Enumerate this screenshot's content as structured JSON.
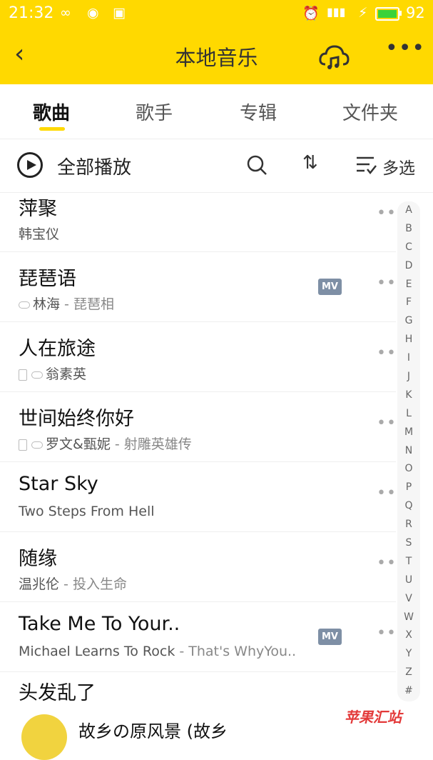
{
  "status_bar": {
    "time": "21:32",
    "battery": "92"
  },
  "header": {
    "title": "本地音乐",
    "back_icon": "chevron-left-icon",
    "cloud_icon": "cloud-music-icon",
    "more_icon": "more-icon"
  },
  "tabs": [
    {
      "label": "歌曲",
      "active": true
    },
    {
      "label": "歌手",
      "active": false
    },
    {
      "label": "专辑",
      "active": false
    },
    {
      "label": "文件夹",
      "active": false
    }
  ],
  "toolbar": {
    "play_all": "全部播放",
    "multi_select": "多选"
  },
  "songs": [
    {
      "title": "萍聚",
      "artist": "韩宝仪",
      "album": ""
    },
    {
      "title": "琵琶语",
      "artist": "林海",
      "album": " - 琵琶相",
      "mv": "MV"
    },
    {
      "title": "人在旅途",
      "artist": "翁素英",
      "album": ""
    },
    {
      "title": "世间始终你好",
      "artist": "罗文&甄妮",
      "album": " - 射雕英雄传"
    },
    {
      "title": "Star Sky",
      "artist": "Two Steps From Hell",
      "album": ""
    },
    {
      "title": "随缘",
      "artist": "温兆伦",
      "album": " - 投入生命"
    },
    {
      "title": "Take Me To Your..",
      "artist": "Michael Learns To Rock",
      "album": " - That's WhyYou..",
      "mv": "MV"
    },
    {
      "title": "头发乱了",
      "artist": "",
      "album": ""
    }
  ],
  "alphabet": [
    "A",
    "B",
    "C",
    "D",
    "E",
    "F",
    "G",
    "H",
    "I",
    "J",
    "K",
    "L",
    "M",
    "N",
    "O",
    "P",
    "Q",
    "R",
    "S",
    "T",
    "U",
    "V",
    "W",
    "X",
    "Y",
    "Z",
    "#"
  ],
  "mini_player": {
    "title": "故乡の原风景 (故乡"
  },
  "watermark": "苹果汇站",
  "colors": {
    "accent": "#ffd900",
    "mv_badge": "#7e8fa5"
  }
}
